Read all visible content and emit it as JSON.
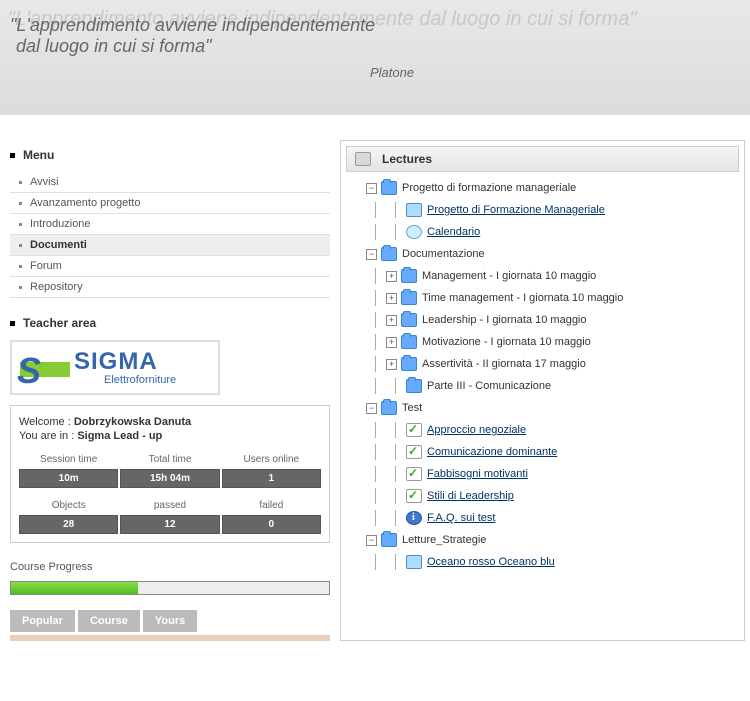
{
  "banner": {
    "quote_line1": "\"L'apprendimento avviene indipendentemente",
    "quote_line2": "dal luogo in cui si forma\"",
    "shadow_full": "\"L'apprendimento avviene indipendentemente dal luogo in cui si forma\"",
    "author": "Platone"
  },
  "menu": {
    "title": "Menu",
    "items": [
      "Avvisi",
      "Avanzamento progetto",
      "Introduzione",
      "Documenti",
      "Forum",
      "Repository"
    ],
    "active_index": 3,
    "teacher_area": "Teacher area"
  },
  "logo": {
    "name": "SIGMA",
    "sub": "Elettroforniture"
  },
  "welcome": {
    "welcome_label": "Welcome : ",
    "user": "Dobrzykowska Danuta",
    "location_label": "You are in : ",
    "location": "Sigma Lead - up"
  },
  "stats1": [
    {
      "label": "Session time",
      "value": "10m"
    },
    {
      "label": "Total time",
      "value": "15h 04m"
    },
    {
      "label": "Users online",
      "value": "1"
    }
  ],
  "stats2": [
    {
      "label": "Objects",
      "value": "28"
    },
    {
      "label": "passed",
      "value": "12"
    },
    {
      "label": "failed",
      "value": "0"
    }
  ],
  "progress": {
    "label": "Course Progress"
  },
  "tabs": [
    "Popular",
    "Course",
    "Yours"
  ],
  "lectures": {
    "title": "Lectures",
    "tree": [
      {
        "depth": 0,
        "toggle": "-",
        "icon": "folder",
        "text": "Progetto di formazione manageriale",
        "link": false
      },
      {
        "depth": 1,
        "icon": "file",
        "text": "Progetto di Formazione Manageriale",
        "link": true
      },
      {
        "depth": 1,
        "icon": "globe",
        "text": "Calendario",
        "link": true
      },
      {
        "depth": 0,
        "toggle": "-",
        "icon": "folder",
        "text": "Documentazione",
        "link": false
      },
      {
        "depth": 1,
        "toggle": "+",
        "icon": "folder",
        "text": "Management - I giornata 10 maggio",
        "link": false
      },
      {
        "depth": 1,
        "toggle": "+",
        "icon": "folder",
        "text": "Time management - I giornata 10 maggio",
        "link": false
      },
      {
        "depth": 1,
        "toggle": "+",
        "icon": "folder",
        "text": "Leadership - I giornata 10 maggio",
        "link": false
      },
      {
        "depth": 1,
        "toggle": "+",
        "icon": "folder",
        "text": "Motivazione - I giornata 10 maggio",
        "link": false
      },
      {
        "depth": 1,
        "toggle": "+",
        "icon": "folder",
        "text": "Assertività - II giornata 17 maggio",
        "link": false
      },
      {
        "depth": 1,
        "icon": "folder",
        "text": "Parte III - Comunicazione",
        "link": false
      },
      {
        "depth": 0,
        "toggle": "-",
        "icon": "folder",
        "text": "Test",
        "link": false
      },
      {
        "depth": 1,
        "icon": "check",
        "text": "Approccio negoziale",
        "link": true
      },
      {
        "depth": 1,
        "icon": "check",
        "text": "Comunicazione dominante",
        "link": true
      },
      {
        "depth": 1,
        "icon": "check",
        "text": "Fabbisogni motivanti",
        "link": true
      },
      {
        "depth": 1,
        "icon": "check",
        "text": "Stili di Leadership",
        "link": true
      },
      {
        "depth": 1,
        "icon": "info",
        "text": "F.A.Q. sui test",
        "link": true
      },
      {
        "depth": 0,
        "toggle": "-",
        "icon": "folder",
        "text": "Letture_Strategie",
        "link": false
      },
      {
        "depth": 1,
        "icon": "file",
        "text": "Oceano rosso  Oceano blu",
        "link": true
      }
    ]
  }
}
